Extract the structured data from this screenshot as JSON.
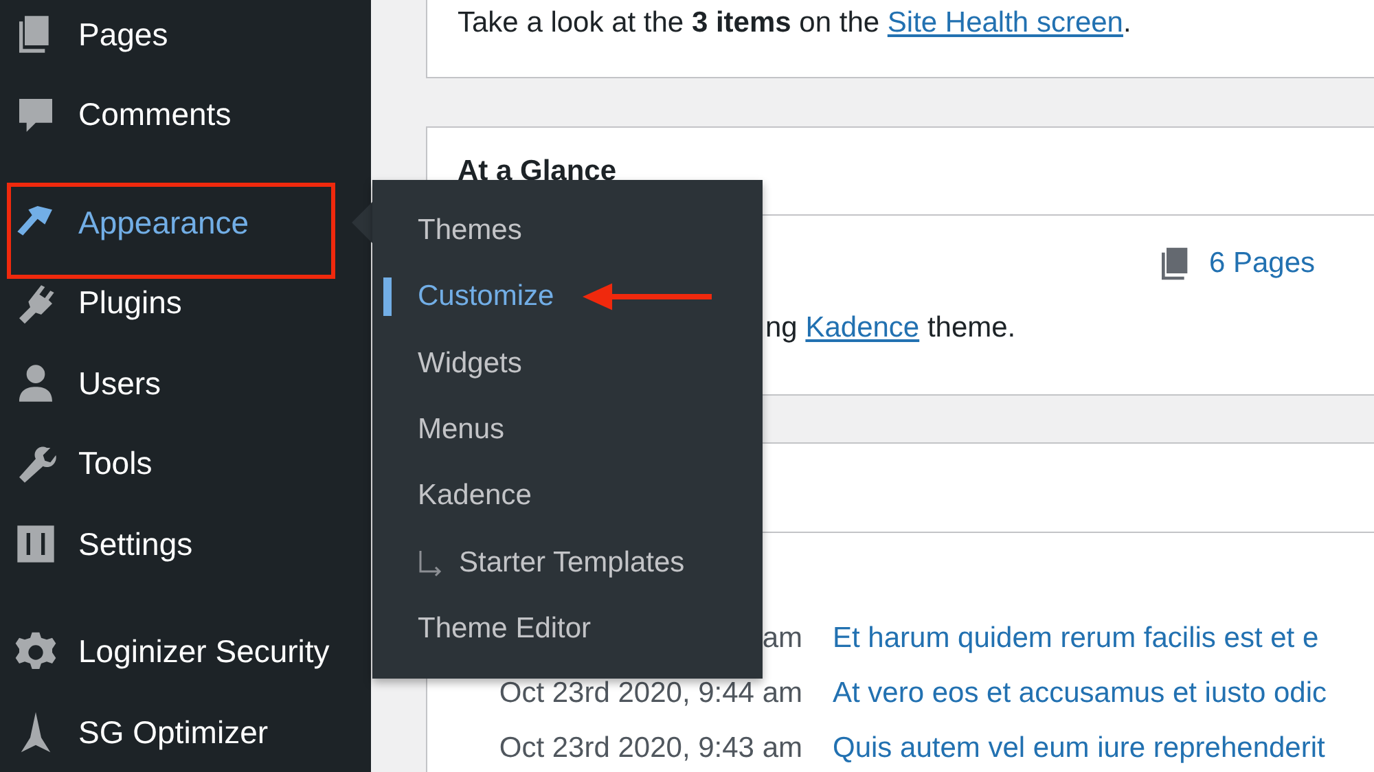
{
  "sidebar": {
    "items": [
      {
        "label": "Pages",
        "selected": false,
        "group_start": false
      },
      {
        "label": "Comments",
        "selected": false,
        "group_start": false
      },
      {
        "label": "Appearance",
        "selected": true,
        "group_start": true
      },
      {
        "label": "Plugins",
        "selected": false,
        "group_start": false
      },
      {
        "label": "Users",
        "selected": false,
        "group_start": false
      },
      {
        "label": "Tools",
        "selected": false,
        "group_start": false
      },
      {
        "label": "Settings",
        "selected": false,
        "group_start": false
      },
      {
        "label": "Loginizer Security",
        "selected": false,
        "group_start": true
      },
      {
        "label": "SG Optimizer",
        "selected": false,
        "group_start": false
      }
    ]
  },
  "flyout": {
    "items": [
      {
        "label": "Themes",
        "kind": "item",
        "selected": false
      },
      {
        "label": "Customize",
        "kind": "item",
        "selected": true
      },
      {
        "label": "Widgets",
        "kind": "item",
        "selected": false
      },
      {
        "label": "Menus",
        "kind": "item",
        "selected": false
      },
      {
        "label": "Kadence",
        "kind": "item",
        "selected": false
      },
      {
        "label": "Starter Templates",
        "kind": "subitem",
        "selected": false
      },
      {
        "label": "Theme Editor",
        "kind": "item",
        "selected": false
      }
    ]
  },
  "site_health": {
    "text_before": "Take a look at the **3 items** on the ",
    "link": "Site Health screen",
    "text_after": "."
  },
  "at_a_glance": {
    "title": "At a Glance",
    "pages": "6 Pages",
    "theme_before": "ng ",
    "theme_link": "Kadence",
    "theme_after": " theme."
  },
  "activity": {
    "rows": [
      {
        "date": "am",
        "title": "Et harum quidem rerum facilis est et e"
      },
      {
        "date": "Oct 23rd 2020, 9:44 am",
        "title": "At vero eos et accusamus et iusto odic"
      },
      {
        "date": "Oct 23rd 2020, 9:43 am",
        "title": "Quis autem vel eum iure reprehenderit"
      }
    ]
  }
}
